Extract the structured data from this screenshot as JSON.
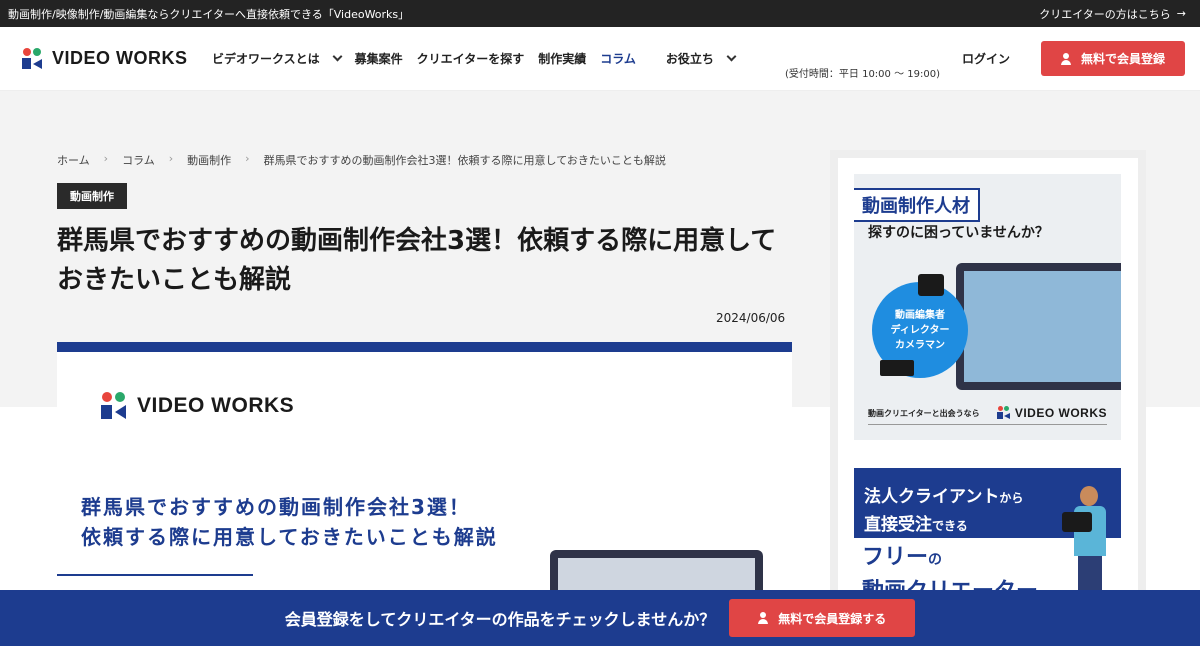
{
  "topbar": {
    "tagline": "動画制作/映像制作/動画編集ならクリエイターへ直接依頼できる「VideoWorks」",
    "creator_link": "クリエイターの方はこちら",
    "arrow": "→"
  },
  "header": {
    "logo_text": "VIDEO WORKS",
    "nav": [
      {
        "label": "ビデオワークスとは",
        "dropdown": true
      },
      {
        "label": "募集案件",
        "dropdown": false
      },
      {
        "label": "クリエイターを探す",
        "dropdown": false
      },
      {
        "label": "制作実績",
        "dropdown": false
      },
      {
        "label": "コラム",
        "dropdown": false,
        "active": true
      },
      {
        "label": "お役立ち",
        "dropdown": true
      }
    ],
    "hours": "(受付時間：平日 10:00 ～ 19:00)",
    "login": "ログイン",
    "register": "無料で会員登録"
  },
  "breadcrumb": [
    "ホーム",
    "コラム",
    "動画制作",
    "群馬県でおすすめの動画制作会社3選！依頼する際に用意しておきたいことも解説"
  ],
  "article": {
    "category": "動画制作",
    "title": "群馬県でおすすめの動画制作会社3選！依頼する際に用意しておきたいことも解説",
    "date": "2024/06/06"
  },
  "hero": {
    "logo_text": "VIDEO WORKS",
    "title_line1": "群馬県でおすすめの動画制作会社3選！",
    "title_line2": "依頼する際に用意しておきたいことも解説"
  },
  "sidebar": {
    "banner1": {
      "tag": "動画制作人材",
      "sub": "探すのに困っていませんか？",
      "circle_line1": "動画編集者",
      "circle_line2": "ディレクター",
      "circle_line3": "カメラマン",
      "footer_small": "動画クリエイターと出会うなら",
      "footer_logo": "VIDEO WORKS"
    },
    "banner2": {
      "line1_main": "法人クライアント",
      "line1_small": "から",
      "line2_main": "直接受注",
      "line2_small": "できる",
      "big_main": "フリー",
      "big_small": "の",
      "big_line2": "動画クリエーター"
    }
  },
  "bottombar": {
    "message": "会員登録をしてクリエイターの作品をチェックしませんか？",
    "cta": "無料で会員登録する"
  },
  "colors": {
    "brand_blue": "#1d3c8f",
    "accent_red": "#e04545"
  }
}
